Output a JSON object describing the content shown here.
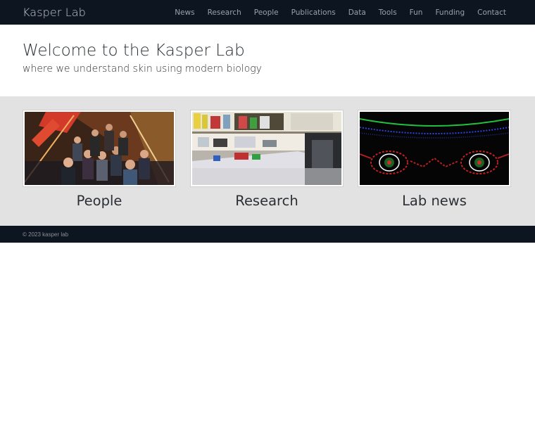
{
  "brand": "Kasper Lab",
  "nav": {
    "items": [
      "News",
      "Research",
      "People",
      "Publications",
      "Data",
      "Tools",
      "Fun",
      "Funding",
      "Contact"
    ]
  },
  "hero": {
    "title": "Welcome to the Kasper Lab",
    "subtitle": "where we understand skin using modern biology"
  },
  "cards": [
    {
      "label": "People"
    },
    {
      "label": "Research"
    },
    {
      "label": "Lab news"
    }
  ],
  "footer": {
    "text": "© 2023 kasper lab"
  },
  "colors": {
    "navbar": "#0d1520",
    "panel": "#e2e2e2"
  }
}
